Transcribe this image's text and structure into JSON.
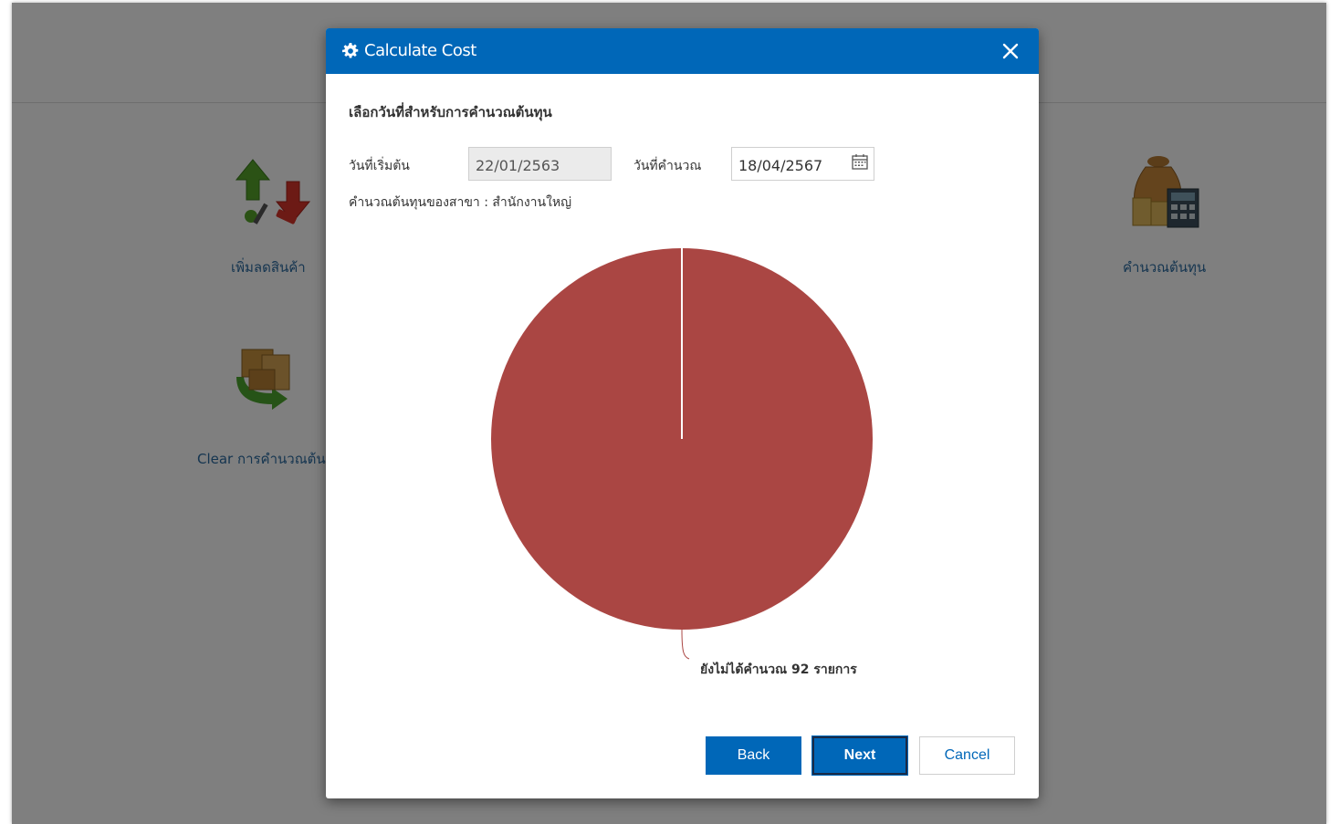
{
  "background": {
    "tiles": [
      {
        "label": "เพิ่มลดสินค้า",
        "icon": "stock-adjust-icon"
      },
      {
        "label": "Clear การคำนวณต้น",
        "icon": "clear-calc-icon"
      },
      {
        "label": "คำนวณต้นทุน",
        "icon": "money-calculator-icon"
      }
    ]
  },
  "modal": {
    "title": "Calculate Cost",
    "heading": "เลือกวันที่สำหรับการคำนวณต้นทุน",
    "start_label": "วันที่เริ่มต้น",
    "start_value": "22/01/2563",
    "calc_label": "วันที่คำนวณ",
    "calc_value": "18/04/2567",
    "branch_text": "คำนวณต้นทุนของสาขา : สำนักงานใหญ่",
    "buttons": {
      "back": "Back",
      "next": "Next",
      "cancel": "Cancel"
    }
  },
  "colors": {
    "header": "#0067b8",
    "slice": "#aa4643"
  },
  "chart_data": {
    "type": "pie",
    "series": [
      {
        "label": "ยังไม่ได้คำนวณ 92 รายการ",
        "value": 92,
        "color": "#aa4643"
      }
    ]
  }
}
